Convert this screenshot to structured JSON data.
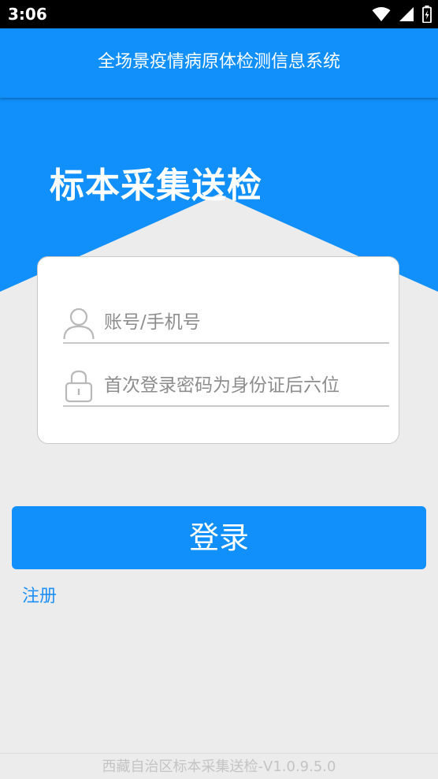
{
  "status_bar": {
    "time": "3:06",
    "icons": [
      "wifi-icon",
      "signal-icon",
      "battery-icon"
    ]
  },
  "header": {
    "title": "全场景疫情病原体检测信息系统"
  },
  "hero": {
    "title": "标本采集送检"
  },
  "login_form": {
    "account_placeholder": "账号/手机号",
    "account_value": "",
    "password_placeholder": "首次登录密码为身份证后六位",
    "password_value": "",
    "account_icon": "user-icon",
    "password_icon": "lock-icon"
  },
  "actions": {
    "login_label": "登录",
    "register_label": "注册"
  },
  "footer": {
    "text": "西藏自治区标本采集送检-V1.0.9.5.0"
  },
  "colors": {
    "primary": "#1190fb",
    "background": "#ececec",
    "link": "#1e8ff5",
    "placeholder": "#8d8d8d",
    "footer_text": "#c4c4c4"
  }
}
